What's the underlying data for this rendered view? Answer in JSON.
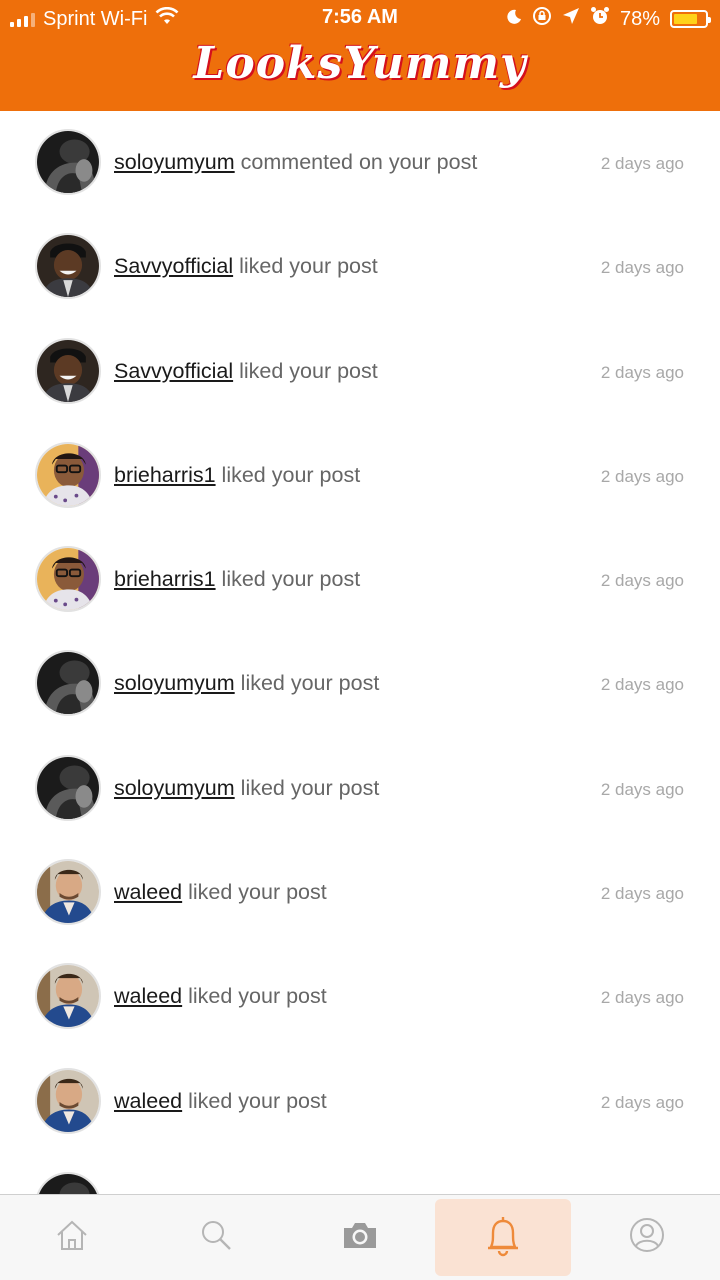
{
  "status_bar": {
    "carrier": "Sprint Wi-Fi",
    "time": "7:56 AM",
    "battery": "78%",
    "battery_level": 0.78
  },
  "header": {
    "logo_text": "LooksYummy",
    "logo_color": "#d4101c",
    "bar_color": "#ee6f0b"
  },
  "notifications": [
    {
      "user": "soloyumyum",
      "action": "commented on your post",
      "time": "2 days ago",
      "avatar": "bw"
    },
    {
      "user": "Savvyofficial",
      "action": "liked your post",
      "time": "2 days ago",
      "avatar": "savvy"
    },
    {
      "user": "Savvyofficial",
      "action": "liked your post",
      "time": "2 days ago",
      "avatar": "savvy"
    },
    {
      "user": "brieharris1",
      "action": "liked your post",
      "time": "2 days ago",
      "avatar": "brie"
    },
    {
      "user": "brieharris1",
      "action": "liked your post",
      "time": "2 days ago",
      "avatar": "brie"
    },
    {
      "user": "soloyumyum",
      "action": "liked your post",
      "time": "2 days ago",
      "avatar": "bw"
    },
    {
      "user": "soloyumyum",
      "action": "liked your post",
      "time": "2 days ago",
      "avatar": "bw"
    },
    {
      "user": "waleed",
      "action": "liked your post",
      "time": "2 days ago",
      "avatar": "waleed"
    },
    {
      "user": "waleed",
      "action": "liked your post",
      "time": "2 days ago",
      "avatar": "waleed"
    },
    {
      "user": "waleed",
      "action": "liked your post",
      "time": "2 days ago",
      "avatar": "waleed"
    },
    {
      "user": "",
      "action": "",
      "time": "",
      "avatar": "bw"
    }
  ],
  "tab_bar": {
    "tabs": [
      {
        "icon": "home-icon",
        "active": false
      },
      {
        "icon": "search-icon",
        "active": false
      },
      {
        "icon": "camera-icon",
        "active": false
      },
      {
        "icon": "bell-icon",
        "active": true
      },
      {
        "icon": "profile-icon",
        "active": false
      }
    ],
    "active_color": "#ee8a3a"
  }
}
